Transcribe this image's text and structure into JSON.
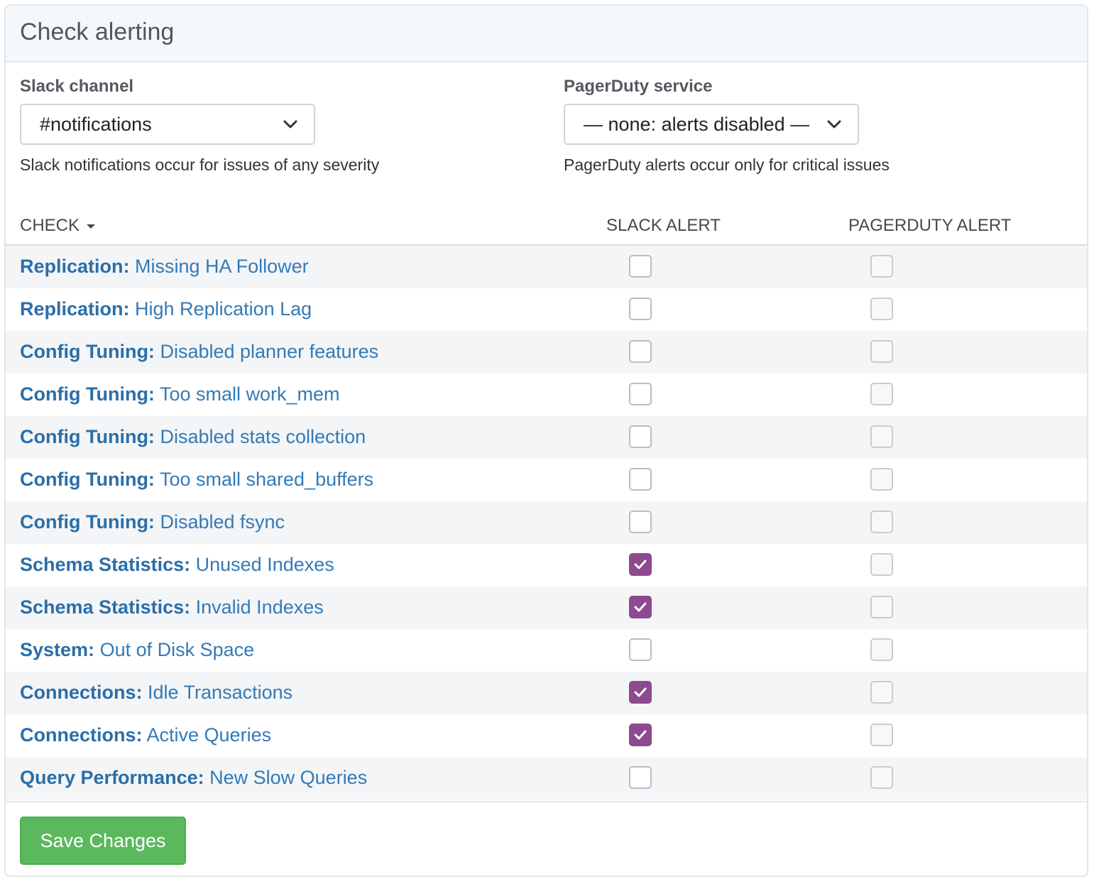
{
  "panel": {
    "title": "Check alerting"
  },
  "slack": {
    "label": "Slack channel",
    "selected": "#notifications",
    "help": "Slack notifications occur for issues of any severity"
  },
  "pagerduty": {
    "label": "PagerDuty service",
    "selected": "— none: alerts disabled —",
    "help": "PagerDuty alerts occur only for critical issues"
  },
  "table": {
    "headers": {
      "check": "CHECK",
      "slack": "SLACK ALERT",
      "pagerduty": "PAGERDUTY ALERT"
    },
    "rows": [
      {
        "category": "Replication:",
        "name": "Missing HA Follower",
        "slack": false,
        "pagerduty": false
      },
      {
        "category": "Replication:",
        "name": "High Replication Lag",
        "slack": false,
        "pagerduty": false
      },
      {
        "category": "Config Tuning:",
        "name": "Disabled planner features",
        "slack": false,
        "pagerduty": false
      },
      {
        "category": "Config Tuning:",
        "name": "Too small work_mem",
        "slack": false,
        "pagerduty": false
      },
      {
        "category": "Config Tuning:",
        "name": "Disabled stats collection",
        "slack": false,
        "pagerduty": false
      },
      {
        "category": "Config Tuning:",
        "name": "Too small shared_buffers",
        "slack": false,
        "pagerduty": false
      },
      {
        "category": "Config Tuning:",
        "name": "Disabled fsync",
        "slack": false,
        "pagerduty": false
      },
      {
        "category": "Schema Statistics:",
        "name": "Unused Indexes",
        "slack": true,
        "pagerduty": false
      },
      {
        "category": "Schema Statistics:",
        "name": "Invalid Indexes",
        "slack": true,
        "pagerduty": false
      },
      {
        "category": "System:",
        "name": "Out of Disk Space",
        "slack": false,
        "pagerduty": false
      },
      {
        "category": "Connections:",
        "name": "Idle Transactions",
        "slack": true,
        "pagerduty": false
      },
      {
        "category": "Connections:",
        "name": "Active Queries",
        "slack": true,
        "pagerduty": false
      },
      {
        "category": "Query Performance:",
        "name": "New Slow Queries",
        "slack": false,
        "pagerduty": false
      }
    ]
  },
  "footer": {
    "save_label": "Save Changes"
  },
  "colors": {
    "accent_checkbox": "#8e4a8f",
    "link": "#337ab7",
    "save_button": "#5cb85c"
  },
  "icons": {
    "select_chevron": "chevron-down-icon",
    "checkmark": "checkmark-icon",
    "sort": "caret-down-icon"
  }
}
